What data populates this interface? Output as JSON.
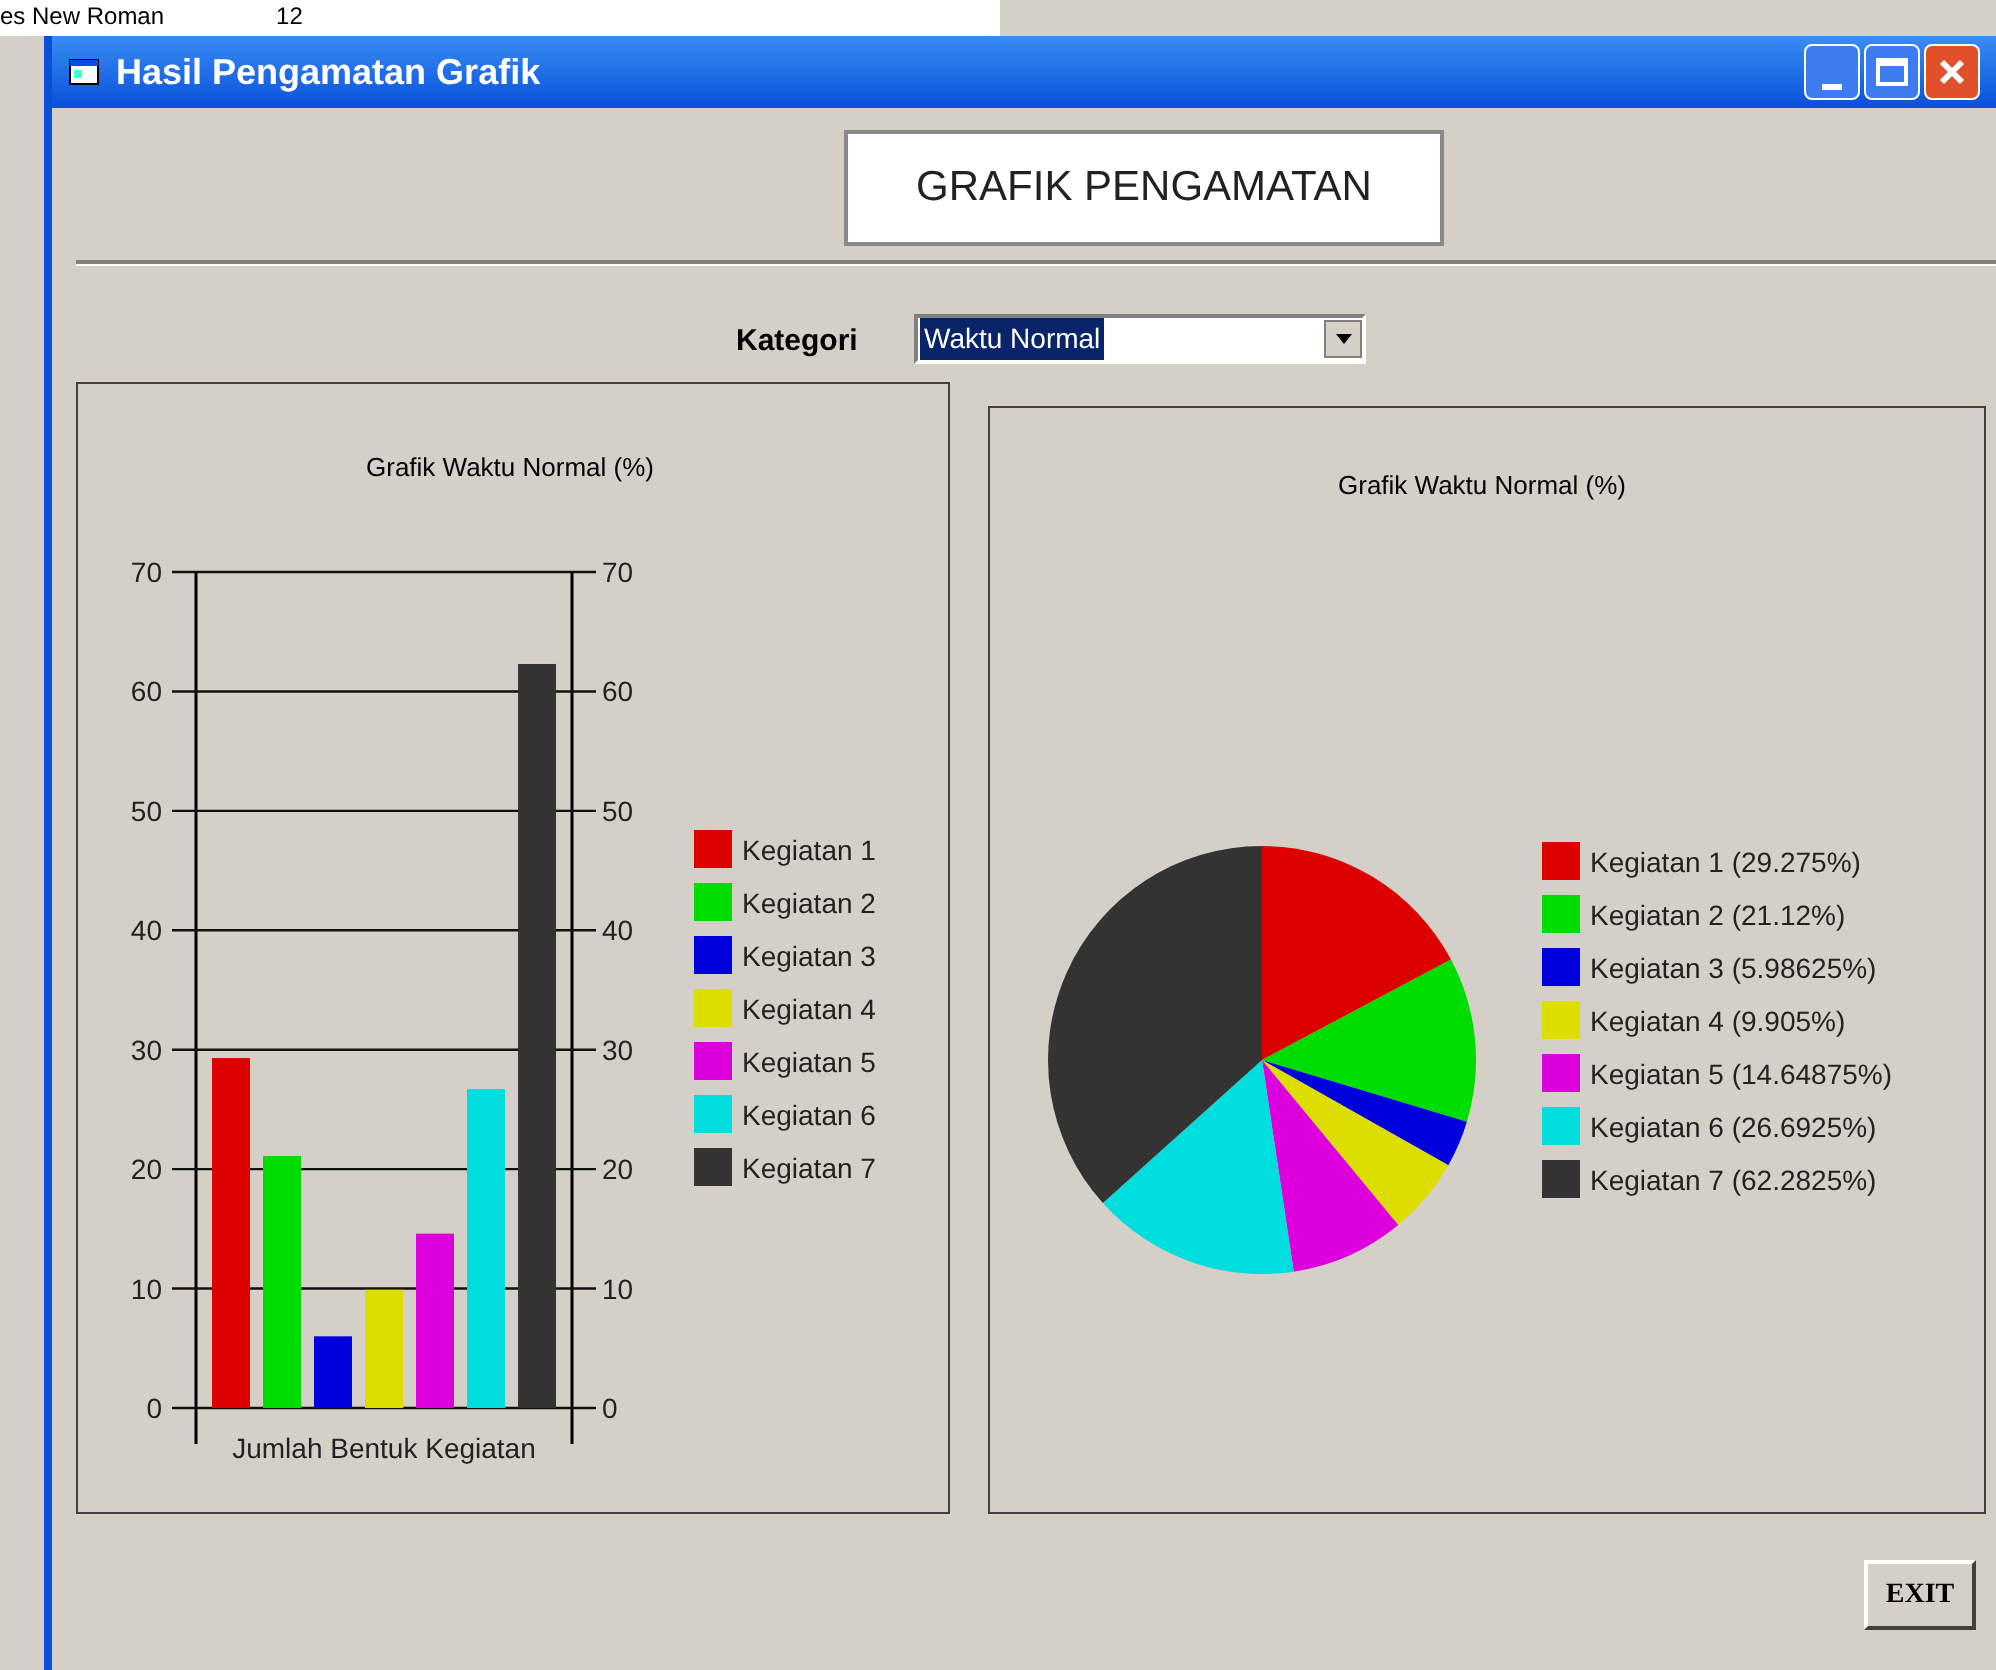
{
  "background": {
    "font_name": "es New Roman",
    "font_size": "12"
  },
  "window": {
    "title": "Hasil Pengamatan Grafik"
  },
  "heading": "GRAFIK PENGAMATAN",
  "kategori": {
    "label": "Kategori",
    "value": "Waktu Normal"
  },
  "bar_panel": {
    "chart_data": {
      "type": "bar",
      "title": "Grafik Waktu Normal (%)",
      "xlabel": "Jumlah Bentuk Kegiatan",
      "ylim": [
        0,
        70
      ],
      "yticks": [
        0,
        10,
        20,
        30,
        40,
        50,
        60,
        70
      ],
      "y2lim": [
        0,
        70
      ],
      "y2ticks": [
        0,
        10,
        20,
        30,
        40,
        50,
        60,
        70
      ],
      "grid": true,
      "legend": true,
      "series": [
        {
          "name": "Kegiatan 1",
          "color": "#dd0000",
          "values": [
            29.3
          ]
        },
        {
          "name": "Kegiatan 2",
          "color": "#00dd00",
          "values": [
            21.1
          ]
        },
        {
          "name": "Kegiatan 3",
          "color": "#0000dd",
          "values": [
            6.0
          ]
        },
        {
          "name": "Kegiatan 4",
          "color": "#dddd00",
          "values": [
            9.9
          ]
        },
        {
          "name": "Kegiatan 5",
          "color": "#dd00dd",
          "values": [
            14.6
          ]
        },
        {
          "name": "Kegiatan 6",
          "color": "#00dddd",
          "values": [
            26.7
          ]
        },
        {
          "name": "Kegiatan 7",
          "color": "#333333",
          "values": [
            62.3
          ]
        }
      ]
    }
  },
  "pie_panel": {
    "chart_data": {
      "type": "pie",
      "title": "Grafik Waktu Normal (%)",
      "legend": true,
      "categories": [
        "Kegiatan 1 (29.275%)",
        "Kegiatan 2 (21.12%)",
        "Kegiatan 3 (5.98625%)",
        "Kegiatan 4 (9.905%)",
        "Kegiatan 5 (14.64875%)",
        "Kegiatan 6 (26.6925%)",
        "Kegiatan 7 (62.2825%)"
      ],
      "colors": [
        "#dd0000",
        "#00dd00",
        "#0000dd",
        "#dddd00",
        "#dd00dd",
        "#00dddd",
        "#333333"
      ],
      "values": [
        29.275,
        21.12,
        5.98625,
        9.905,
        14.64875,
        26.6925,
        62.2825
      ]
    }
  },
  "exit_button": "EXIT"
}
